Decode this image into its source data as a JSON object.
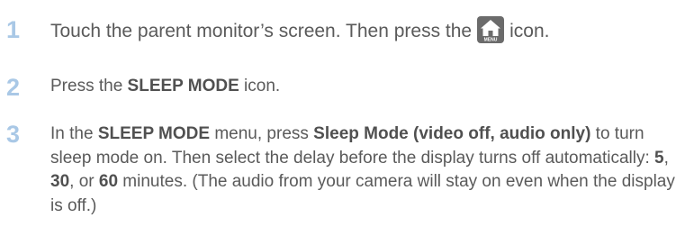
{
  "steps": [
    {
      "number": "1",
      "text_before": "Touch the parent monitor’s screen. Then press the",
      "icon": "home-menu-icon",
      "icon_label": "MENU",
      "text_after": "icon."
    },
    {
      "number": "2",
      "t1": "Press the ",
      "b1": "SLEEP MODE",
      "t2": " icon."
    },
    {
      "number": "3",
      "t1": "In the ",
      "b1": "SLEEP MODE",
      "t2": " menu, press ",
      "b2": "Sleep Mode (video off, audio only)",
      "t3": " to turn sleep mode on. Then select the delay before the display turns off automatically: ",
      "b3": "5",
      "t4": ", ",
      "b4": "30",
      "t5": ", or ",
      "b5": "60",
      "t6": " minutes. (The audio from your camera will stay on even when the display is off.)"
    }
  ],
  "colors": {
    "step_number": "#a9c8e6",
    "body_text": "#5a5a5a",
    "icon_bg": "#6b6b6b"
  }
}
